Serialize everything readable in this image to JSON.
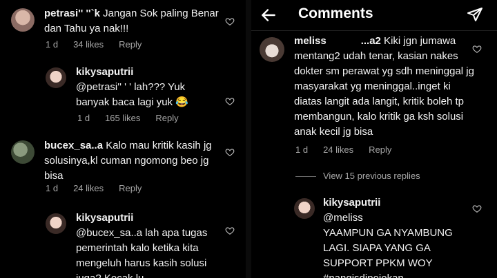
{
  "left": {
    "c1": {
      "username": "petrasi'' ''`k",
      "text": " Jangan Sok paling Benar dan Tahu ya nak!!!",
      "age": "1 d",
      "likes": "34 likes",
      "reply": "Reply"
    },
    "c2": {
      "username": "kikysaputrii",
      "text": "@petrasi'' ' ' lah??? Yuk banyak baca lagi yuk 😂",
      "age": "1 d",
      "likes": "165 likes",
      "reply": "Reply"
    },
    "c3": {
      "username": "bucex_sa..a",
      "text": " Kalo mau kritik kasih jg solusinya,kl cuman ngomong beo jg bisa",
      "age": "1 d",
      "likes": "24 likes",
      "reply": "Reply"
    },
    "c4": {
      "username": "kikysaputrii",
      "text": "@bucex_sa..a lah apa tugas pemerintah kalo ketika kita mengeluh harus kasih solusi juga? Kocak lu"
    }
  },
  "right": {
    "header": {
      "title": "Comments",
      "back_icon": "back-arrow-icon",
      "send_icon": "send-icon"
    },
    "c1": {
      "username": "meliss",
      "username_tail": "...a2",
      "text": " Kiki jgn jumawa mentang2 udah tenar, kasian nakes dokter sm perawat yg sdh meninggal jg masyarakat yg meninggal..inget ki diatas langit ada langit, kritik boleh tp membangun, kalo kritik ga ksh solusi anak kecil jg bisa",
      "age": "1 d",
      "likes": "24 likes",
      "reply": "Reply"
    },
    "view_replies": "View 15 previous replies",
    "c2": {
      "username": "kikysaputrii",
      "mention": "@meliss",
      "text": "YAAMPUN GA NYAMBUNG LAGI. SIAPA YANG GA SUPPORT PPKM WOY #nangisdipojokan"
    }
  }
}
